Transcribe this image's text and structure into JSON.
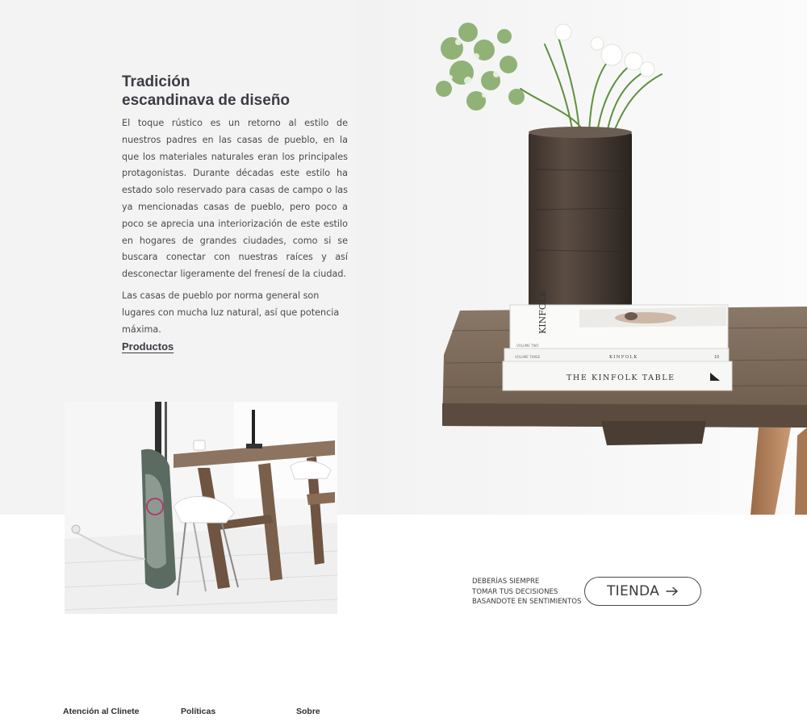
{
  "intro": {
    "title_line1": "Tradición",
    "title_line2": "escandinava de diseño",
    "paragraph1": "El toque rústico es un retorno al estilo de nuestros padres en las casas de pueblo, en la que los materiales naturales eran los principales protagonistas. Durante décadas este estilo ha estado solo reservado para casas de campo o las ya mencionadas casas de pueblo, pero poco a poco se aprecia una interiorización de este estilo en hogares de grandes ciudades, como si se buscara conectar con nuestras raíces y así desconectar ligeramente del frenesí de la ciudad.",
    "paragraph2": "Las casas de pueblo por norma general son lugares con mucha luz natural, así que potencia máxima.",
    "link_label": "Productos"
  },
  "hero_image": {
    "icon": "vase-flowers-books-table-photo",
    "book_top_spine": "KINFOLK",
    "book_top_vol": "VOLUME TWO",
    "book_middle": "KINFOLK",
    "book_middle_vol": "VOLUME THREE",
    "book_middle_num": "10",
    "book_bottom_title": "THE KINFOLK TABLE"
  },
  "desk_image": {
    "icon": "wooden-desk-chair-photo"
  },
  "cta": {
    "tagline_line1": "DEBERÍAS SIEMPRE",
    "tagline_line2": "TOMAR TUS DECISIONES",
    "tagline_line3": "BASANDOTE EN SENTIMIENTOS",
    "button_label": "TIENDA",
    "button_icon": "arrow-right-icon"
  },
  "footer": {
    "col1": "Atención al Clinete",
    "col2": "Políticas",
    "col3": "Sobre"
  },
  "colors": {
    "hero_background": "#f3f3f3",
    "heading": "#3b3d44",
    "body_text": "#4a4a4a"
  }
}
